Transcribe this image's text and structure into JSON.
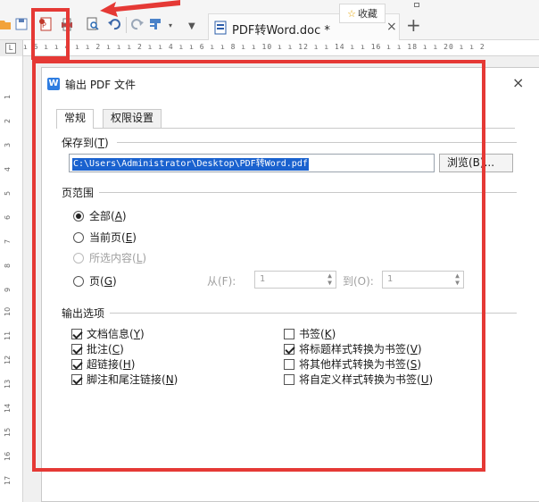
{
  "toolbar": {
    "doc_tab": {
      "name": "PDF转Word.doc *",
      "close": "×"
    },
    "favorite": {
      "star": "☆",
      "label": "收藏"
    },
    "new_tab": "+",
    "icons": [
      "folder-icon",
      "save-icon",
      "export-pdf-icon",
      "print-icon",
      "print-preview-icon",
      "undo-icon",
      "redo-icon",
      "format-painter-icon"
    ]
  },
  "ruler": {
    "top_scale": "ı  6 ı  ı 4 ı  ı 2 ı  ı    ı 2 ı  ı 4 ı  ı 6 ı  ı 8 ı  ı 10 ı  ı 12 ı  ı 14 ı  ı 16 ı  ı 18 ı  ı 20 ı  ı 2",
    "corner": "L",
    "left_numbers": [
      "1",
      "2",
      "3",
      "4",
      "5",
      "6",
      "7",
      "8",
      "9",
      "10",
      "11",
      "12",
      "13",
      "14",
      "15",
      "16",
      "17"
    ]
  },
  "dialog": {
    "icon": "W",
    "title": "输出 PDF 文件",
    "close": "×",
    "tabs": [
      "常规",
      "权限设置"
    ],
    "save_to": {
      "label": "保存到(",
      "mnemonic": "T",
      "label_end": ")",
      "path": "C:\\Users\\Administrator\\Desktop\\PDF转Word.pdf",
      "browse_label": "浏览(B)..."
    },
    "page_range": {
      "label": "页范围",
      "all": {
        "text": "全部(",
        "key": "A",
        "end": ")",
        "checked": true
      },
      "current": {
        "text": "当前页(",
        "key": "E",
        "end": ")"
      },
      "selection": {
        "text": "所选内容(",
        "key": "L",
        "end": ")",
        "disabled": true
      },
      "pages": {
        "text": "页(",
        "key": "G",
        "end": ")"
      },
      "from_label": "从(F):",
      "from_value": "1",
      "to_label": "到(O):",
      "to_value": "1"
    },
    "output_options": {
      "label": "输出选项",
      "left": [
        {
          "text": "文档信息(",
          "key": "Y",
          "end": ")",
          "checked": true
        },
        {
          "text": "批注(",
          "key": "C",
          "end": ")",
          "checked": true
        },
        {
          "text": "超链接(",
          "key": "H",
          "end": ")",
          "checked": true
        },
        {
          "text": "脚注和尾注链接(",
          "key": "N",
          "end": ")",
          "checked": true
        }
      ],
      "right": [
        {
          "text": "书签(",
          "key": "K",
          "end": ")",
          "checked": false
        },
        {
          "text": "将标题样式转换为书签(",
          "key": "V",
          "end": ")",
          "checked": true
        },
        {
          "text": "将其他样式转换为书签(",
          "key": "S",
          "end": ")",
          "checked": false
        },
        {
          "text": "将自定义样式转换为书签(",
          "key": "U",
          "end": ")",
          "checked": false
        }
      ]
    }
  },
  "colors": {
    "highlight": "#e53935",
    "selection": "#1a62cf",
    "accent": "#2f7de1"
  }
}
